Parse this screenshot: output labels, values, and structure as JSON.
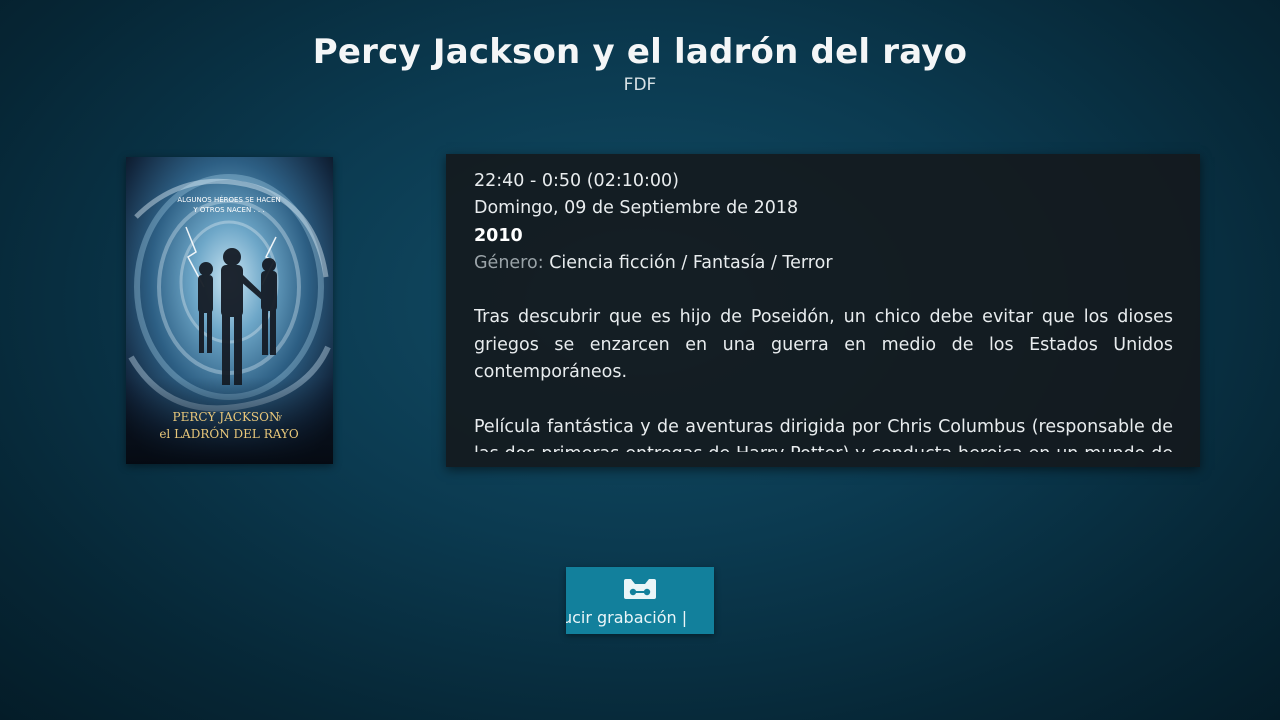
{
  "header": {
    "title": "Percy Jackson y el ladrón del rayo",
    "channel": "FDF"
  },
  "poster": {
    "tagline_line1": "ALGUNOS HÉROES SE HACEN",
    "tagline_line2": "Y OTROS NACEN . . .",
    "logo_line1": "PERCY JACKSON",
    "logo_y": "y",
    "logo_line2": "el LADRÓN DEL RAYO"
  },
  "info": {
    "time_range": "22:40 - 0:50 (02:10:00)",
    "date": "Domingo, 09 de Septiembre de 2018",
    "year": "2010",
    "genre_label": "Género:",
    "genre_value": "Ciencia ficción / Fantasía / Terror",
    "plot_paragraph_1": "Tras descubrir que es hijo de Poseidón, un chico debe evitar que los dioses griegos se enzarcen en una guerra en medio de los Estados Unidos contemporáneos.",
    "plot_paragraph_2": "Película fantástica y de aventuras dirigida por Chris Columbus (responsable de las dos primeras entregas de Harry Potter) y conducta heroica en un mundo de dioses"
  },
  "action_button": {
    "label": "oducir grabación |",
    "icon": "recording-tape-icon"
  },
  "colors": {
    "button_background": "#12809c",
    "panel_background": "#14181b",
    "genre_label": "#9aa3a8"
  }
}
